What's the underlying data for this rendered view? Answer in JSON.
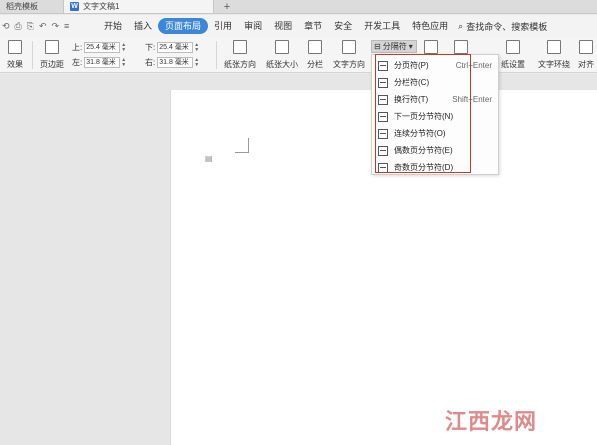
{
  "tabs": {
    "first": "稻壳模板",
    "doc_badge": "W",
    "doc": "文字文稿1",
    "add": "+"
  },
  "quick_access": [
    "⟲",
    "⎙",
    "⎘",
    "↶",
    "↷",
    "≡"
  ],
  "menu": {
    "items": [
      "开始",
      "插入",
      "页面布局",
      "引用",
      "审阅",
      "视图",
      "章节",
      "安全",
      "开发工具",
      "特色应用"
    ],
    "active_index": 2,
    "search": "查找命令、搜索模板"
  },
  "ribbon": {
    "effects_label": "效果",
    "margins_label": "页边距",
    "top_label": "上:",
    "top_value": "25.4 毫米",
    "bottom_label": "下:",
    "bottom_value": "25.4 毫米",
    "left_label": "左:",
    "left_value": "31.8 毫米",
    "right_label": "右:",
    "right_value": "31.8 毫米",
    "orientation_label": "纸张方向",
    "size_label": "纸张大小",
    "columns_label": "分栏",
    "text_dir_label": "文字方向",
    "separator_label": "分隔符",
    "paper_settings_label": "纸设置",
    "wrap_label": "文字环绕",
    "align_label": "对齐"
  },
  "dropdown": {
    "items": [
      {
        "label": "分页符(P)",
        "shortcut": "Ctrl+Enter"
      },
      {
        "label": "分栏符(C)",
        "shortcut": ""
      },
      {
        "label": "换行符(T)",
        "shortcut": "Shift+Enter"
      },
      {
        "label": "下一页分节符(N)",
        "shortcut": ""
      },
      {
        "label": "连续分节符(O)",
        "shortcut": ""
      },
      {
        "label": "偶数页分节符(E)",
        "shortcut": ""
      },
      {
        "label": "奇数页分节符(D)",
        "shortcut": ""
      }
    ]
  },
  "watermark": "江西龙网",
  "colors": {
    "active_tab": "#3d87d8",
    "highlight": "#c0392b",
    "doc_badge": "#2f6fd6"
  }
}
